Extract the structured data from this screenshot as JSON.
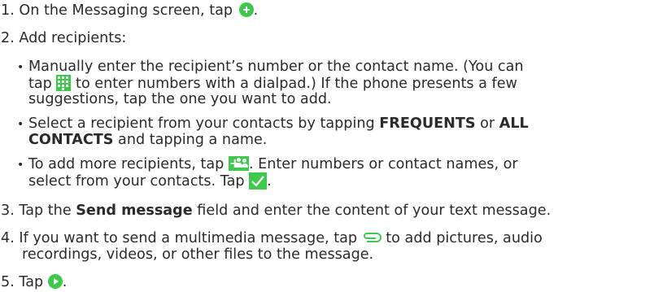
{
  "steps": [
    {
      "number": "1.",
      "text_before": "On the Messaging screen, tap",
      "text_after": ".",
      "icon": "add-circle-icon"
    },
    {
      "number": "2.",
      "text": "Add recipients:",
      "bullets": [
        {
          "lines": [
            "Manually enter the recipient’s number or the contact name. (You can",
            "to enter numbers with a dialpad.) If the phone presents a few",
            "suggestions, tap the one you want to add."
          ],
          "line2_prefix": "tap",
          "icon": "dialpad-icon"
        },
        {
          "line1_prefix": "Select a recipient from your contacts by tapping",
          "bold1": "FREQUENTS",
          "line1_mid": "or",
          "bold2": "ALL",
          "bold3": "CONTACTS",
          "line2_suffix": "and tapping a name."
        },
        {
          "line1_prefix": "To add more recipients, tap",
          "line1_suffix": ". Enter numbers or contact names, or",
          "line2_prefix": "select from your contacts. Tap",
          "line2_suffix": ".",
          "icon1": "add-people-icon",
          "icon2": "checkmark-icon"
        }
      ]
    },
    {
      "number": "3.",
      "prefix": "Tap the",
      "bold": "Send message",
      "suffix": "field and enter the content of your text message."
    },
    {
      "number": "4.",
      "prefix": "If you want to send a multimedia message, tap",
      "suffix": "to add pictures, audio",
      "line2": "recordings, videos, or other files to the message.",
      "icon": "paperclip-icon"
    },
    {
      "number": "5.",
      "prefix": "Tap",
      "suffix": ".",
      "icon": "send-icon"
    }
  ],
  "colors": {
    "accent": "#3ec94d",
    "text": "#2b2b2b"
  }
}
